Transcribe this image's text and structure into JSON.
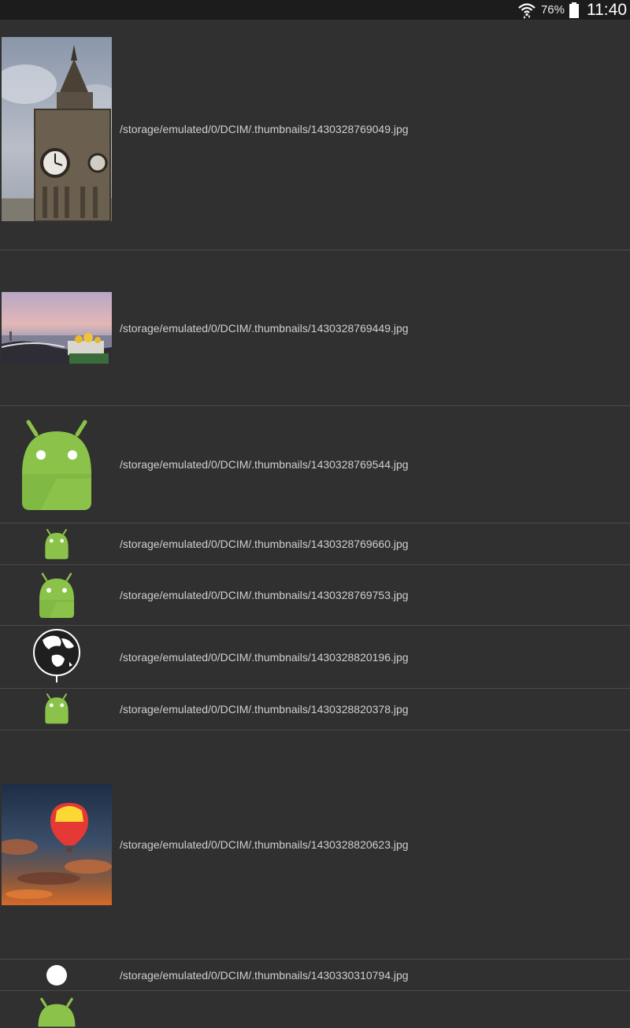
{
  "status_bar": {
    "battery_percent": "76%",
    "time": "11:40",
    "icons": [
      "wifi-icon",
      "battery-icon"
    ]
  },
  "items": [
    {
      "path": "/storage/emulated/0/DCIM/.thumbnails/1430328769049.jpg",
      "thumb": "big-ben-clock-tower-photo"
    },
    {
      "path": "/storage/emulated/0/DCIM/.thumbnails/1430328769449.jpg",
      "thumb": "city-river-bridge-photo"
    },
    {
      "path": "/storage/emulated/0/DCIM/.thumbnails/1430328769544.jpg",
      "thumb": "android-robot-icon"
    },
    {
      "path": "/storage/emulated/0/DCIM/.thumbnails/1430328769660.jpg",
      "thumb": "android-robot-icon"
    },
    {
      "path": "/storage/emulated/0/DCIM/.thumbnails/1430328769753.jpg",
      "thumb": "android-robot-icon"
    },
    {
      "path": "/storage/emulated/0/DCIM/.thumbnails/1430328820196.jpg",
      "thumb": "globe-icon"
    },
    {
      "path": "/storage/emulated/0/DCIM/.thumbnails/1430328820378.jpg",
      "thumb": "android-robot-icon"
    },
    {
      "path": "/storage/emulated/0/DCIM/.thumbnails/1430328820623.jpg",
      "thumb": "hot-air-balloon-photo"
    },
    {
      "path": "/storage/emulated/0/DCIM/.thumbnails/1430330310794.jpg",
      "thumb": "white-circle-icon"
    },
    {
      "path": "",
      "thumb": "android-robot-icon"
    }
  ]
}
